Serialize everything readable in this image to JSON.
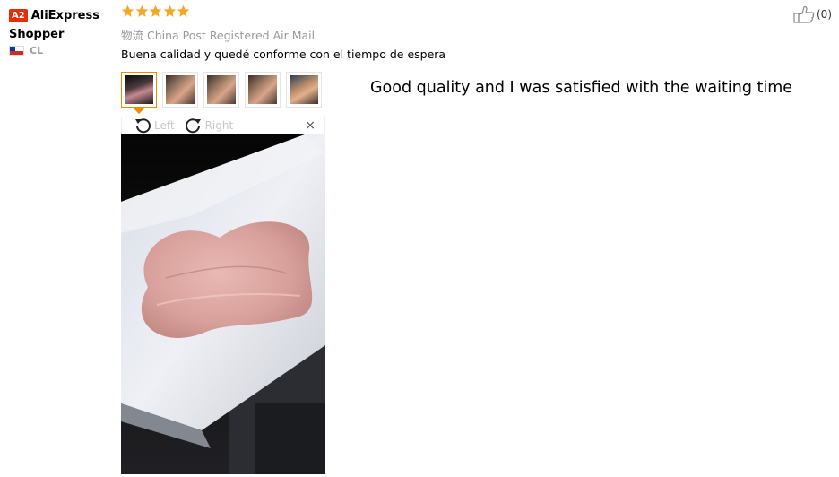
{
  "user": {
    "badge": "A2",
    "name": "AliExpress Shopper",
    "country": "CL"
  },
  "review": {
    "rating": 5,
    "shipping": "物流 China Post Registered Air Mail",
    "text": "Buena calidad y quedé conforme con el tiempo de espera",
    "translation": "Good quality and I was satisfied with the waiting time"
  },
  "gallery": {
    "thumbnail_count": 5,
    "active_index": 0,
    "rotate_left": "Left",
    "rotate_right": "Right",
    "close": "×"
  },
  "helpful": {
    "count": "(0)"
  },
  "icons": [
    "star-icon",
    "thumbs-up-icon",
    "rotate-left-icon",
    "rotate-right-icon",
    "close-icon",
    "flag-cl-icon"
  ],
  "colors": {
    "star": "#f5a623",
    "badge": "#e62e04",
    "active_thumb": "#f08b00"
  }
}
